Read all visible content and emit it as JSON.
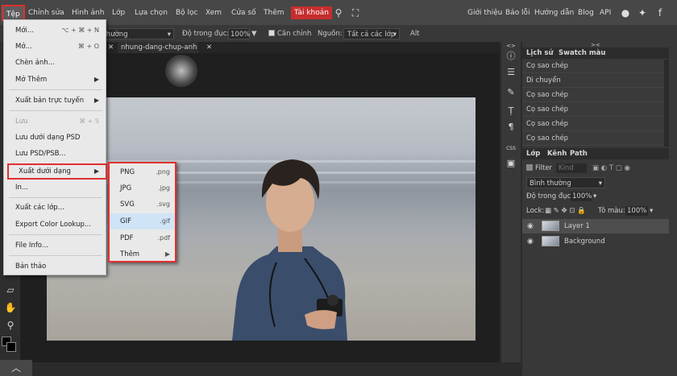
{
  "menubar": {
    "items": [
      "Tệp",
      "Chỉnh sửa",
      "Hình ảnh",
      "Lớp",
      "Lựa chọn",
      "Bộ lọc",
      "Xem",
      "Cửa số",
      "Thêm",
      "Tài khoản"
    ],
    "right_links": [
      "Giới thiệu",
      "Báo lỗi",
      "Hướng dẫn",
      "Blog",
      "API"
    ]
  },
  "options": {
    "blend": "nh thường",
    "opacity_label": "Độ trong đục:",
    "opacity_value": "100%",
    "align_label": "Căn chỉnh",
    "source_label": "Nguồn:",
    "source_value": "Tất cả các lớp",
    "alt_label": "Alt"
  },
  "tabs": [
    "nhung-dang-chup-anh"
  ],
  "file_menu": {
    "items": [
      {
        "label": "Mới...",
        "shortcut": "⌥ + ⌘ + N"
      },
      {
        "label": "Mở...",
        "shortcut": "⌘ + O"
      },
      {
        "label": "Chèn ảnh...",
        "shortcut": ""
      },
      {
        "label": "Mở Thêm",
        "shortcut": ""
      },
      {
        "label": "Xuất bản trực tuyến",
        "shortcut": ""
      },
      {
        "label": "Lưu",
        "shortcut": "⌘ + S"
      },
      {
        "label": "Lưu dưới dạng PSD",
        "shortcut": ""
      },
      {
        "label": "Lưu PSD/PSB...",
        "shortcut": ""
      },
      {
        "label": "Xuất dưới dạng",
        "shortcut": ""
      },
      {
        "label": "In...",
        "shortcut": ""
      },
      {
        "label": "Xuất các lớp...",
        "shortcut": ""
      },
      {
        "label": "Export Color Lookup...",
        "shortcut": ""
      },
      {
        "label": "File Info...",
        "shortcut": ""
      },
      {
        "label": "Bản thảo",
        "shortcut": ""
      }
    ]
  },
  "export_submenu": {
    "items": [
      {
        "label": "PNG",
        "ext": ".png"
      },
      {
        "label": "JPG",
        "ext": ".jpg"
      },
      {
        "label": "SVG",
        "ext": ".svg"
      },
      {
        "label": "GIF",
        "ext": ".gif"
      },
      {
        "label": "PDF",
        "ext": ".pdf"
      },
      {
        "label": "Thêm",
        "ext": ""
      }
    ],
    "highlighted": "GIF"
  },
  "history_panel": {
    "tabs": [
      "Lịch sử",
      "Swatch màu"
    ],
    "entries": [
      "Cọ sao chép",
      "Di chuyển",
      "Cọ sao chép",
      "Cọ sao chép",
      "Cọ sao chép",
      "Cọ sao chép",
      "Cọ sao chép"
    ]
  },
  "layers_panel": {
    "tabs": [
      "Lớp",
      "Kênh",
      "Path"
    ],
    "filter_label": "Filter",
    "kind_label": "Kind",
    "blend_mode": "Bình thường",
    "opacity_label": "Độ trong đục:",
    "opacity_value": "100%",
    "lock_label": "Lock:",
    "fill_label": "Tô màu:",
    "fill_value": "100%",
    "layers": [
      "Layer 1",
      "Background"
    ]
  },
  "panel_icons": [
    "info-icon",
    "sliders-icon",
    "brush-icon",
    "text-icon",
    "paragraph-icon",
    "css-icon",
    "image-icon"
  ],
  "panel_collapse_labels": [
    "<>",
    "><"
  ],
  "css_label": "CSS",
  "colors": {
    "accent_red": "#e0302f",
    "menu_bg": "#e9e9e9",
    "highlight": "#cfe4f7"
  }
}
